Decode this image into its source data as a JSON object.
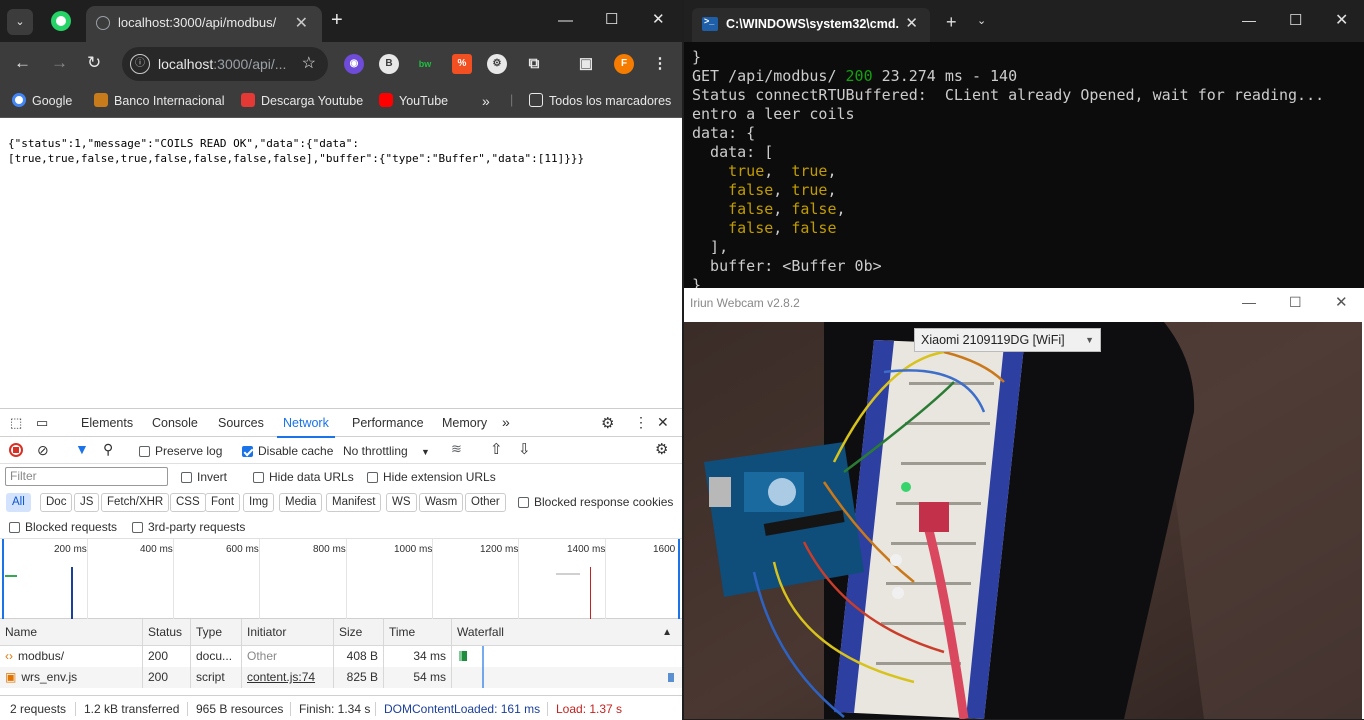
{
  "browser": {
    "tab_title": "localhost:3000/api/modbus/",
    "omnibox": {
      "host": "localhost",
      "path": ":3000/api/...",
      "info_glyph": "ⓘ"
    },
    "profile_initial": "F",
    "bookmarks": [
      {
        "label": "Google",
        "color": "#4285f4"
      },
      {
        "label": "Banco Internacional",
        "color": "#c77b1b"
      },
      {
        "label": "Descarga Youtube",
        "color": "#e53935"
      },
      {
        "label": "YouTube",
        "color": "#ff0000"
      },
      {
        "label": "Todos los marcadores",
        "color": "#9aa0a6"
      }
    ],
    "page_text_line1": "{\"status\":1,\"message\":\"COILS READ OK\",\"data\":{\"data\":",
    "page_text_line2": "[true,true,false,true,false,false,false,false],\"buffer\":{\"type\":\"Buffer\",\"data\":[11]}}}"
  },
  "devtools": {
    "tabs": [
      "Elements",
      "Console",
      "Sources",
      "Network",
      "Performance",
      "Memory"
    ],
    "active_tab": "Network",
    "controls": {
      "preserve_log": "Preserve log",
      "disable_cache": "Disable cache",
      "throttling": "No throttling"
    },
    "filter_placeholder": "Filter",
    "filter_options": {
      "invert": "Invert",
      "hide_data_urls": "Hide data URLs",
      "hide_extension_urls": "Hide extension URLs"
    },
    "type_chips": [
      "All",
      "Doc",
      "JS",
      "Fetch/XHR",
      "CSS",
      "Font",
      "Img",
      "Media",
      "Manifest",
      "WS",
      "Wasm",
      "Other"
    ],
    "blocked_response_cookies": "Blocked response cookies",
    "blocked_requests": "Blocked requests",
    "third_party_requests": "3rd-party requests",
    "timeline_ticks": [
      "200 ms",
      "400 ms",
      "600 ms",
      "800 ms",
      "1000 ms",
      "1200 ms",
      "1400 ms",
      "1600"
    ],
    "columns": [
      "Name",
      "Status",
      "Type",
      "Initiator",
      "Size",
      "Time",
      "Waterfall"
    ],
    "rows": [
      {
        "name": "modbus/",
        "status": "200",
        "type": "docu...",
        "initiator": "Other",
        "size": "408 B",
        "time": "34 ms"
      },
      {
        "name": "wrs_env.js",
        "status": "200",
        "type": "script",
        "initiator": "content.js:74",
        "size": "825 B",
        "time": "54 ms"
      }
    ],
    "status_bar": {
      "requests": "2 requests",
      "transferred": "1.2 kB transferred",
      "resources": "965 B resources",
      "finish": "Finish: 1.34 s",
      "dom_content_loaded": "DOMContentLoaded: 161 ms",
      "load": "Load: 1.37 s"
    }
  },
  "terminal": {
    "tab_title": "C:\\WINDOWS\\system32\\cmd.",
    "lines": {
      "l0": "}",
      "l1a": "GET /api/modbus/ ",
      "l1b": "200",
      "l1c": " 23.274 ms - 140",
      "l2": "Status connectRTUBuffered:  CLient already Opened, wait for reading...",
      "l3": "entro a leer coils",
      "l4": "data: {",
      "l5": "  data: [",
      "l6a": "true",
      "l6b": "true",
      "l7a": "false",
      "l7b": "true",
      "l8a": "false",
      "l8b": "false",
      "l9a": "false",
      "l9b": "false",
      "l10": "  ],",
      "l11": "  buffer: <Buffer 0b>",
      "l12": "}"
    }
  },
  "webcam": {
    "title": "Iriun Webcam v2.8.2",
    "device": "Xiaomi 2109119DG [WiFi]"
  }
}
